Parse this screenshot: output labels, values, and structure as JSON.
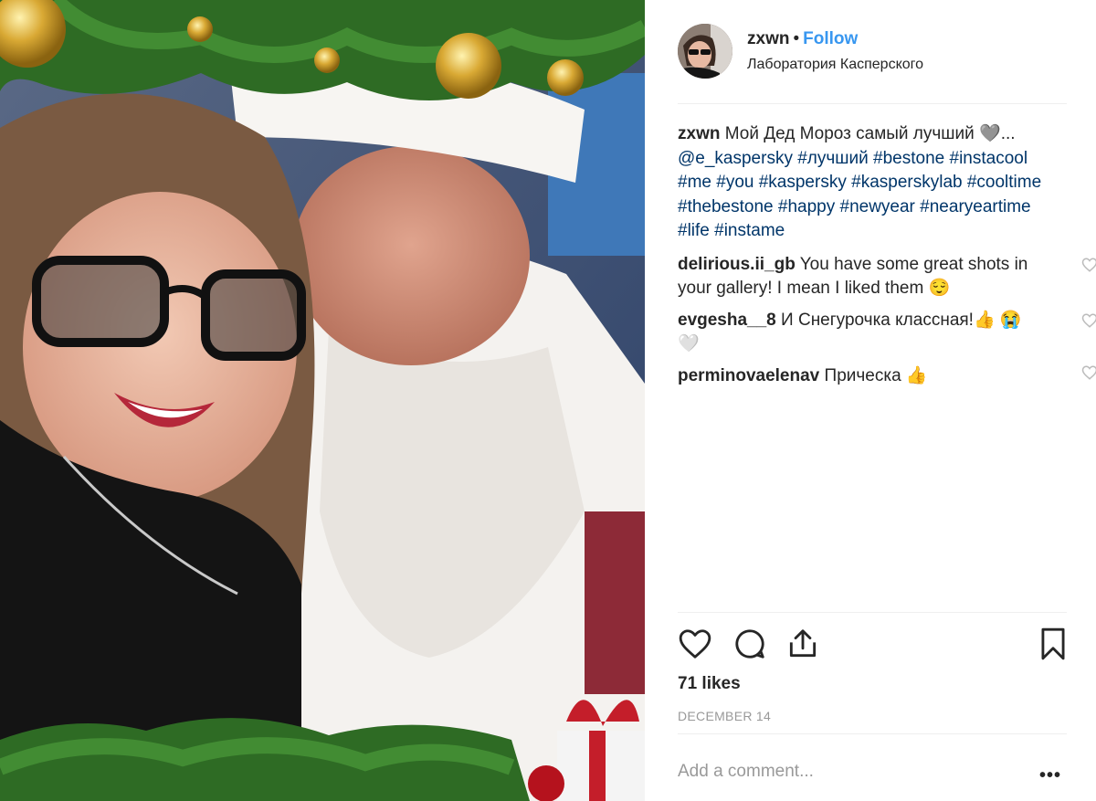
{
  "post": {
    "username": "zxwn",
    "separator": "•",
    "follow_label": "Follow",
    "location": "Лаборатория Касперского"
  },
  "caption": {
    "author": "zxwn",
    "text": "Мой Дед Мороз самый лучший 🩶...",
    "mention": "@e_kaspersky",
    "tags": [
      "#лучший",
      "#bestone",
      "#instacool",
      "#me",
      "#you",
      "#kaspersky",
      "#kasperskylab",
      "#cooltime",
      "#thebestone",
      "#happy",
      "#newyear",
      "#nearyeartime",
      "#life",
      "#instame"
    ]
  },
  "comments": [
    {
      "author": "delirious.ii_gb",
      "text": "You have some great shots in your gallery! I mean I liked them 😌"
    },
    {
      "author": "evgesha__8",
      "text": "И Снегурочка классная!👍 😭🤍"
    },
    {
      "author": "perminovaelenav",
      "text": "Прическа 👍"
    }
  ],
  "likes": "71 likes",
  "date": "DECEMBER 14",
  "add_comment_placeholder": "Add a comment...",
  "more_label": "•••",
  "icons": {
    "like": "heart-icon",
    "comment": "comment-icon",
    "share": "share-icon",
    "save": "bookmark-icon",
    "comment_like": "heart-icon"
  },
  "colors": {
    "link": "#3897f0",
    "hashtag": "#003569",
    "text": "#262626",
    "muted": "#999999"
  }
}
